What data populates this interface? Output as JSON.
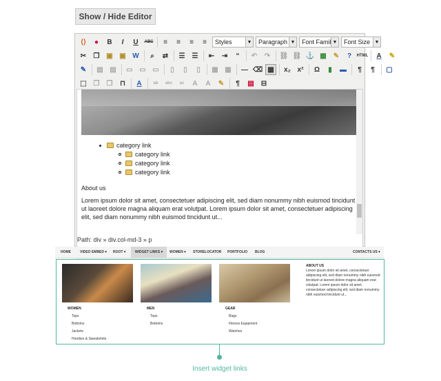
{
  "toggle_label": "Show / Hide Editor",
  "toolbar": {
    "styles": "Styles",
    "format": "Paragraph",
    "font_family": "Font Family",
    "font_size": "Font Size"
  },
  "content": {
    "list_top": "category link",
    "list_sub": [
      "category link",
      "category link",
      "category link"
    ],
    "heading": "About us",
    "paragraph": "Lorem ipsum dolor sit amet, consectetuer adipiscing elit, sed diam nonummy nibh euismod tincidunt ut laoreet dolore magna aliquam erat volutpat. Lorem ipsum dolor sit amet, consectetuer adipiscing elit, sed diam nonummy nibh euismod tincidunt ut..."
  },
  "path_text": "Path: div » div.col-md-3 » p",
  "nav": {
    "items": [
      "HOME",
      "VIDEO EMBED ▾",
      "ROOT ▾",
      "WIDGET LINKS ▾",
      "WOMEN ▾",
      "STORELOCATOR",
      "PORTFOLIO",
      "BLOG"
    ],
    "right": "CONTACTS US ▾"
  },
  "columns": [
    {
      "title": "WOMEN",
      "items": [
        "Tops",
        "Bottoms",
        "Jackets",
        "Hoodies & Sweatshirts"
      ]
    },
    {
      "title": "MEN",
      "items": [
        "Tops",
        "Bottoms"
      ]
    },
    {
      "title": "GEAR",
      "items": [
        "Bags",
        "Fitness Equipment",
        "Watches"
      ]
    }
  ],
  "about": {
    "title": "ABOUT US",
    "text": "Lorem ipsum dolor sit amet, consectetuer adipiscing elit, sed diam nonummy nibh euismod tincidunt ut laoreet dolore magna aliquam erat volutpat. Lorem ipsum dolor sit amet, consectetuer adipiscing elit, sed diam nonummy nibh euismod tincidunt ut..."
  },
  "caption": "Insert widget links",
  "accent_color": "#4fb5a0"
}
